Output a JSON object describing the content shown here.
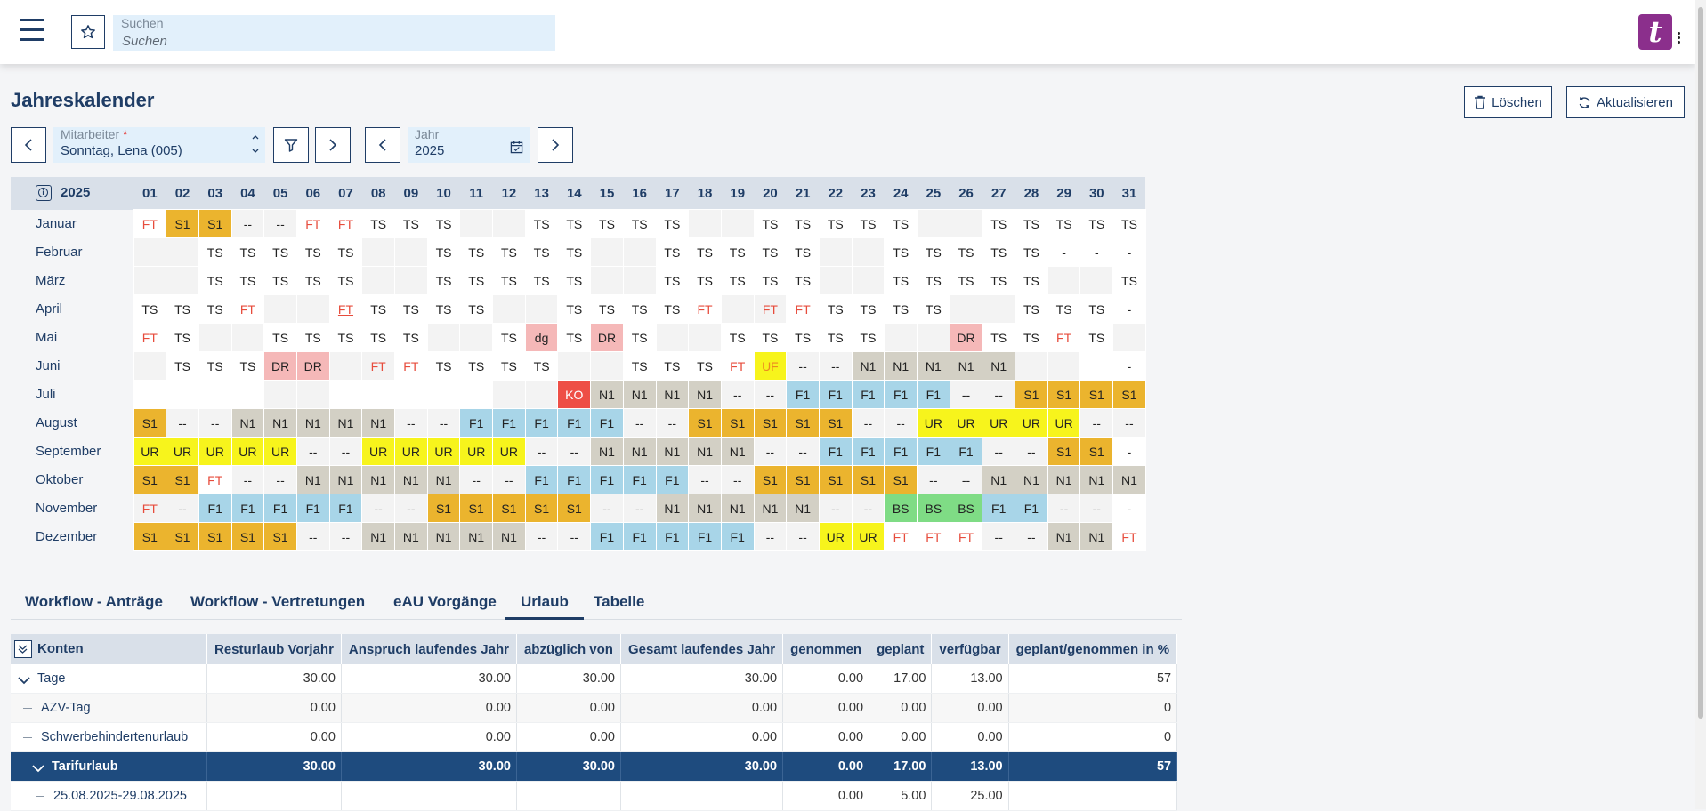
{
  "search": {
    "label": "Suchen",
    "placeholder": "Suchen"
  },
  "logo": {
    "letter": "t"
  },
  "page": {
    "title": "Jahreskalender"
  },
  "actions": {
    "delete": "Löschen",
    "refresh": "Aktualisieren"
  },
  "employee": {
    "label": "Mitarbeiter",
    "required": "*",
    "value": "Sonntag, Lena (005)"
  },
  "year_field": {
    "label": "Jahr",
    "value": "2025"
  },
  "calendar": {
    "year": "2025",
    "days": [
      "01",
      "02",
      "03",
      "04",
      "05",
      "06",
      "07",
      "08",
      "09",
      "10",
      "11",
      "12",
      "13",
      "14",
      "15",
      "16",
      "17",
      "18",
      "19",
      "20",
      "21",
      "22",
      "23",
      "24",
      "25",
      "26",
      "27",
      "28",
      "29",
      "30",
      "31"
    ],
    "months": [
      {
        "name": "Januar",
        "cells": [
          "FT",
          "S1",
          "S1",
          "--",
          "--",
          "FT",
          "FT",
          "TS",
          "TS",
          "TS",
          "",
          "",
          "TS",
          "TS",
          "TS",
          "TS",
          "TS",
          "",
          "",
          "TS",
          "TS",
          "TS",
          "TS",
          "TS",
          "",
          "",
          "TS",
          "TS",
          "TS",
          "TS",
          "TS"
        ]
      },
      {
        "name": "Februar",
        "cells": [
          "",
          "",
          "TS",
          "TS",
          "TS",
          "TS",
          "TS",
          "",
          "",
          "TS",
          "TS",
          "TS",
          "TS",
          "TS",
          "",
          "",
          "TS",
          "TS",
          "TS",
          "TS",
          "TS",
          "",
          "",
          "TS",
          "TS",
          "TS",
          "TS",
          "TS",
          "-",
          "-",
          "-"
        ]
      },
      {
        "name": "März",
        "cells": [
          "",
          "",
          "TS",
          "TS",
          "TS",
          "TS",
          "TS",
          "",
          "",
          "TS",
          "TS",
          "TS",
          "TS",
          "TS",
          "",
          "",
          "TS",
          "TS",
          "TS",
          "TS",
          "TS",
          "",
          "",
          "TS",
          "TS",
          "TS",
          "TS",
          "TS",
          "",
          "",
          "TS"
        ]
      },
      {
        "name": "April",
        "cells": [
          "TS",
          "TS",
          "TS",
          "FT",
          "",
          "",
          "FT",
          "TS",
          "TS",
          "TS",
          "TS",
          "",
          "",
          "TS",
          "TS",
          "TS",
          "TS",
          "FT",
          "",
          "FT",
          "FT",
          "TS",
          "TS",
          "TS",
          "TS",
          "",
          "",
          "TS",
          "TS",
          "TS",
          "-"
        ]
      },
      {
        "name": "Mai",
        "cells": [
          "FT",
          "TS",
          "",
          "",
          "TS",
          "TS",
          "TS",
          "TS",
          "TS",
          "",
          "",
          "TS",
          "dg",
          "TS",
          "DR",
          "TS",
          "",
          "",
          "TS",
          "TS",
          "TS",
          "TS",
          "TS",
          "",
          "",
          "DR",
          "TS",
          "TS",
          "FT",
          "TS",
          ""
        ]
      },
      {
        "name": "Juni",
        "cells": [
          "",
          "TS",
          "TS",
          "TS",
          "DR",
          "DR",
          "",
          "FT",
          "FT",
          "TS",
          "TS",
          "TS",
          "TS",
          "",
          "",
          "TS",
          "TS",
          "TS",
          "FT",
          "UF",
          "--",
          "--",
          "N1",
          "N1",
          "N1",
          "N1",
          "N1",
          "",
          "",
          "",
          "-"
        ]
      },
      {
        "name": "Juli",
        "cells": [
          "",
          "",
          "",
          "",
          "",
          "",
          "",
          "",
          "",
          "",
          "",
          "",
          "",
          "KO",
          "N1",
          "N1",
          "N1",
          "N1",
          "--",
          "--",
          "F1",
          "F1",
          "F1",
          "F1",
          "F1",
          "--",
          "--",
          "S1",
          "S1",
          "S1",
          "S1"
        ]
      },
      {
        "name": "August",
        "cells": [
          "S1",
          "--",
          "--",
          "N1",
          "N1",
          "N1",
          "N1",
          "N1",
          "--",
          "--",
          "F1",
          "F1",
          "F1",
          "F1",
          "F1",
          "--",
          "--",
          "S1",
          "S1",
          "S1",
          "S1",
          "S1",
          "--",
          "--",
          "UR",
          "UR",
          "UR",
          "UR",
          "UR",
          "--",
          "--"
        ]
      },
      {
        "name": "September",
        "cells": [
          "UR",
          "UR",
          "UR",
          "UR",
          "UR",
          "--",
          "--",
          "UR",
          "UR",
          "UR",
          "UR",
          "UR",
          "--",
          "--",
          "N1",
          "N1",
          "N1",
          "N1",
          "N1",
          "--",
          "--",
          "F1",
          "F1",
          "F1",
          "F1",
          "F1",
          "--",
          "--",
          "S1",
          "S1",
          "-"
        ]
      },
      {
        "name": "Oktober",
        "cells": [
          "S1",
          "S1",
          "FT",
          "--",
          "--",
          "N1",
          "N1",
          "N1",
          "N1",
          "N1",
          "--",
          "--",
          "F1",
          "F1",
          "F1",
          "F1",
          "F1",
          "--",
          "--",
          "S1",
          "S1",
          "S1",
          "S1",
          "S1",
          "--",
          "--",
          "N1",
          "N1",
          "N1",
          "N1",
          "N1"
        ]
      },
      {
        "name": "November",
        "cells": [
          "FT",
          "--",
          "F1",
          "F1",
          "F1",
          "F1",
          "F1",
          "--",
          "--",
          "S1",
          "S1",
          "S1",
          "S1",
          "S1",
          "--",
          "--",
          "N1",
          "N1",
          "N1",
          "N1",
          "N1",
          "--",
          "--",
          "BS",
          "BS",
          "BS",
          "F1",
          "F1",
          "--",
          "--",
          "-"
        ]
      },
      {
        "name": "Dezember",
        "cells": [
          "S1",
          "S1",
          "S1",
          "S1",
          "S1",
          "--",
          "--",
          "N1",
          "N1",
          "N1",
          "N1",
          "N1",
          "--",
          "--",
          "F1",
          "F1",
          "F1",
          "F1",
          "F1",
          "--",
          "--",
          "UR",
          "UR",
          "FT",
          "FT",
          "FT",
          "--",
          "--",
          "N1",
          "N1",
          "FT"
        ]
      }
    ]
  },
  "code_colors": {
    "S1": {
      "bg": "#ebb42e",
      "fg": "#222222"
    },
    "N1": {
      "bg": "#d3d0c5",
      "fg": "#222222"
    },
    "F1": {
      "bg": "#a8d5e8",
      "fg": "#222222"
    },
    "UR": {
      "bg": "#f7f41c",
      "fg": "#222222"
    },
    "BS": {
      "bg": "#7fdc85",
      "fg": "#222222"
    },
    "DR": {
      "bg": "#f5b8b8",
      "fg": "#222222"
    },
    "dg": {
      "bg": "#f5b8b8",
      "fg": "#222222"
    },
    "KO": {
      "bg": "#ee4f46",
      "fg": "#ffffff"
    },
    "UF": {
      "bg": "#f7f41c",
      "fg": "#ec8a20"
    },
    "FT": {
      "bg": "",
      "fg": "#e74c3c"
    }
  },
  "tabs": [
    {
      "label": "Workflow - Anträge",
      "active": false
    },
    {
      "label": "Workflow - Vertretungen",
      "active": false
    },
    {
      "label": "eAU Vorgänge",
      "active": false
    },
    {
      "label": "Urlaub",
      "active": true
    },
    {
      "label": "Tabelle",
      "active": false
    }
  ],
  "accounts": {
    "columns": [
      "Konten",
      "Resturlaub Vorjahr",
      "Anspruch laufendes Jahr",
      "abzüglich von",
      "Gesamt laufendes Jahr",
      "genommen",
      "geplant",
      "verfügbar",
      "geplant/genommen in %"
    ],
    "rows": [
      {
        "name": "Tage",
        "level": 0,
        "expander": true,
        "selected": false,
        "values": [
          "30.00",
          "30.00",
          "30.00",
          "30.00",
          "0.00",
          "17.00",
          "13.00",
          "57"
        ]
      },
      {
        "name": "AZV-Tag",
        "level": 1,
        "expander": false,
        "selected": false,
        "values": [
          "0.00",
          "0.00",
          "0.00",
          "0.00",
          "0.00",
          "0.00",
          "0.00",
          "0"
        ]
      },
      {
        "name": "Schwerbehindertenurlaub",
        "level": 1,
        "expander": false,
        "selected": false,
        "values": [
          "0.00",
          "0.00",
          "0.00",
          "0.00",
          "0.00",
          "0.00",
          "0.00",
          "0"
        ]
      },
      {
        "name": "Tarifurlaub",
        "level": 1,
        "expander": true,
        "selected": true,
        "values": [
          "30.00",
          "30.00",
          "30.00",
          "30.00",
          "0.00",
          "17.00",
          "13.00",
          "57"
        ]
      },
      {
        "name": "25.08.2025-29.08.2025",
        "level": 2,
        "expander": false,
        "selected": false,
        "values": [
          "",
          "",
          "",
          "",
          "0.00",
          "5.00",
          "25.00",
          ""
        ]
      }
    ]
  }
}
